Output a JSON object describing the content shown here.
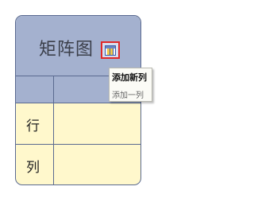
{
  "matrix": {
    "title": "矩阵图",
    "rows": [
      {
        "label": "行"
      },
      {
        "label": "列"
      }
    ],
    "colors": {
      "header_fill": "#a4b1cf",
      "cell_fill": "#fff8cc",
      "border": "#5a6a90"
    }
  },
  "toolbar": {
    "add_column_icon": "add-column-icon",
    "highlight_color": "#e02828"
  },
  "tooltip": {
    "title": "添加新列",
    "description": "添加一列"
  }
}
